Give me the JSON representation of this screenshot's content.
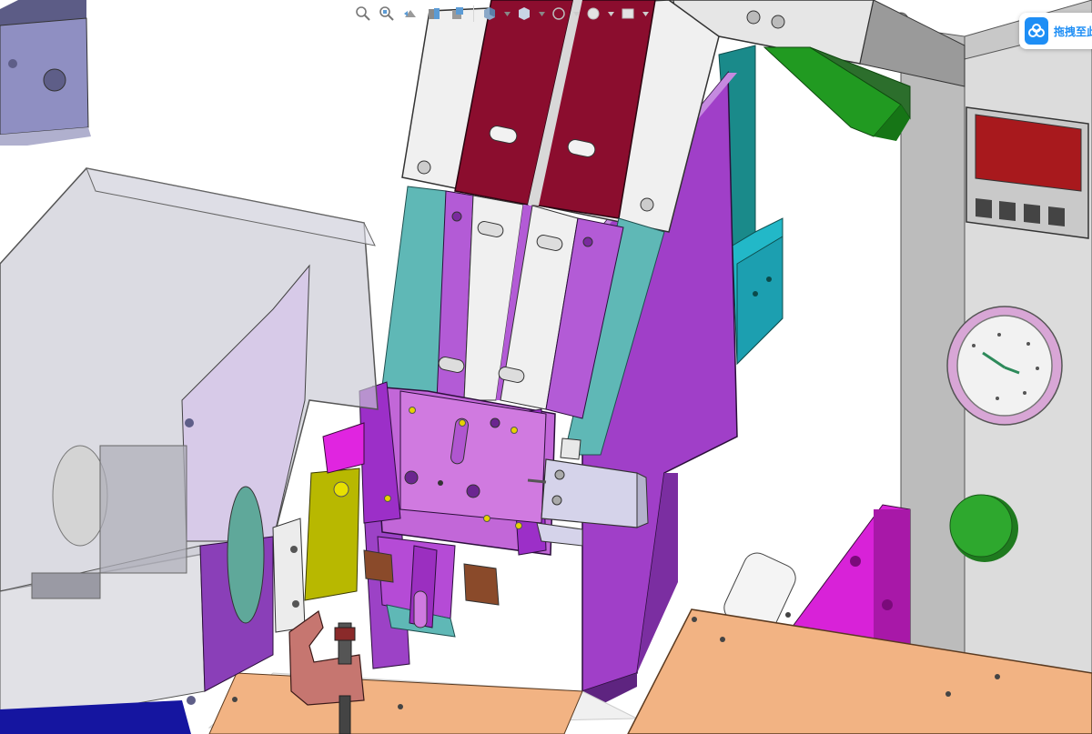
{
  "app": {
    "view_type": "3D CAD assembly viewport",
    "background_color": "#ffffff"
  },
  "heads_up_toolbar": {
    "items": [
      {
        "name": "zoom-to-fit",
        "icon": "zoom-fit-icon"
      },
      {
        "name": "zoom-to-area",
        "icon": "zoom-area-icon"
      },
      {
        "name": "previous-view",
        "icon": "previous-view-icon"
      },
      {
        "name": "section-view",
        "icon": "section-view-icon"
      },
      {
        "name": "dynamic-annotation-views",
        "icon": "annotation-view-icon"
      },
      {
        "name": "view-orientation",
        "icon": "view-orientation-icon",
        "has_dropdown": true
      },
      {
        "name": "display-style",
        "icon": "display-style-icon",
        "has_dropdown": true
      },
      {
        "name": "hide-show-items",
        "icon": "hide-show-icon",
        "has_dropdown": true
      },
      {
        "name": "edit-appearance",
        "icon": "appearance-icon",
        "has_dropdown": true
      },
      {
        "name": "apply-scene",
        "icon": "scene-icon",
        "has_dropdown": true
      },
      {
        "name": "view-settings",
        "icon": "view-settings-icon",
        "has_dropdown": true
      }
    ]
  },
  "overlay_badge": {
    "label": "拖拽至此",
    "icon": "cloud-app-icon",
    "accent_color": "#1e8ef5"
  },
  "model": {
    "controller_display_color": "#a8191d",
    "controller_button_count": 4,
    "gauge_dial_color": "#d8a6d6",
    "start_button_color": "#2ea82e",
    "colors": {
      "slider_plates": "#8b0d2e",
      "guide_rails": "#b35bd6",
      "side_plates": "#8a3fb8",
      "teal_blocks": "#5fb8b6",
      "machine_frame": "#dcdcdc",
      "base_plate": "#f2b383",
      "green_bracket": "#229922",
      "magenta_block": "#d822d8",
      "yellow_block": "#b8b800",
      "cylinder": "#d5d3ea",
      "transparent_cover": "#c8c8d2"
    }
  }
}
